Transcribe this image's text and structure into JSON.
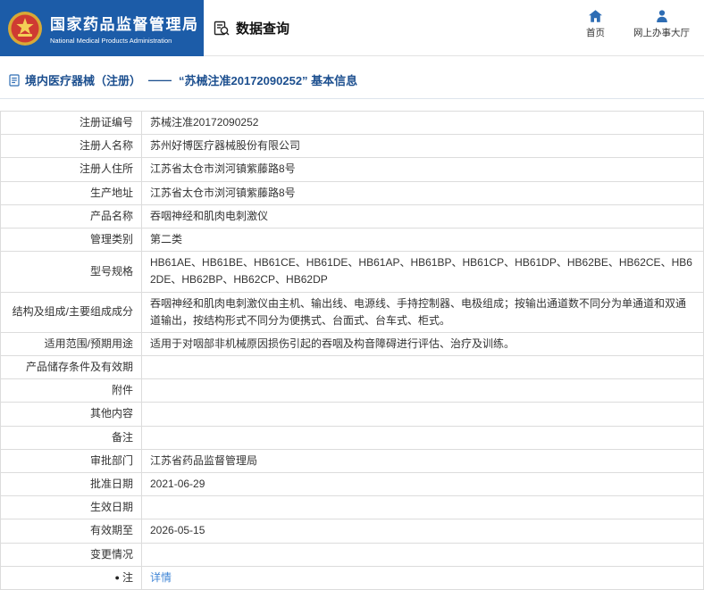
{
  "header": {
    "agency_cn": "国家药品监督管理局",
    "agency_en": "National Medical Products Administration",
    "nav_query": "数据查询",
    "nav_home": "首页",
    "nav_hall": "网上办事大厅"
  },
  "breadcrumb": {
    "section": "境内医疗器械（注册）",
    "separator": "——",
    "title": "“苏械注准20172090252” 基本信息"
  },
  "table": {
    "rows": [
      {
        "label": "注册证编号",
        "value": "苏械注准20172090252"
      },
      {
        "label": "注册人名称",
        "value": "苏州好博医疗器械股份有限公司"
      },
      {
        "label": "注册人住所",
        "value": "江苏省太仓市浏河镇紫藤路8号"
      },
      {
        "label": "生产地址",
        "value": "江苏省太仓市浏河镇紫藤路8号"
      },
      {
        "label": "产品名称",
        "value": "吞咽神经和肌肉电刺激仪"
      },
      {
        "label": "管理类别",
        "value": "第二类"
      },
      {
        "label": "型号规格",
        "value": "HB61AE、HB61BE、HB61CE、HB61DE、HB61AP、HB61BP、HB61CP、HB61DP、HB62BE、HB62CE、HB62DE、HB62BP、HB62CP、HB62DP"
      },
      {
        "label": "结构及组成/主要组成成分",
        "value": "吞咽神经和肌肉电刺激仪由主机、输出线、电源线、手持控制器、电极组成；按输出通道数不同分为单通道和双通道输出，按结构形式不同分为便携式、台面式、台车式、柜式。"
      },
      {
        "label": "适用范围/预期用途",
        "value": "适用于对咽部非机械原因损伤引起的吞咽及构音障碍进行评估、治疗及训练。"
      },
      {
        "label": "产品储存条件及有效期",
        "value": ""
      },
      {
        "label": "附件",
        "value": ""
      },
      {
        "label": "其他内容",
        "value": ""
      },
      {
        "label": "备注",
        "value": ""
      },
      {
        "label": "审批部门",
        "value": "江苏省药品监督管理局"
      },
      {
        "label": "批准日期",
        "value": "2021-06-29"
      },
      {
        "label": "生效日期",
        "value": ""
      },
      {
        "label": "有效期至",
        "value": "2026-05-15"
      },
      {
        "label": "变更情况",
        "value": ""
      },
      {
        "label": "注",
        "value": "详情",
        "link": true,
        "bullet": "●"
      }
    ]
  },
  "colors": {
    "header_blue": "#1c5ca8",
    "nav_blue": "#2e6db4",
    "crumb_blue": "#1c4f8f",
    "link_blue": "#3f85d6"
  }
}
